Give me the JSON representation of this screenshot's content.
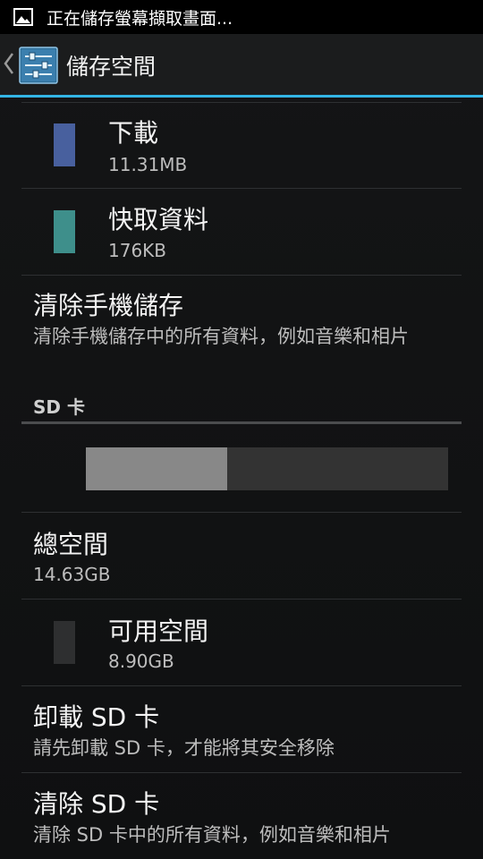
{
  "status_bar": {
    "notification_icon": "picture-icon",
    "text": "正在儲存螢幕擷取畫面..."
  },
  "action_bar": {
    "back_icon": "back-caret-icon",
    "app_icon": "settings-icon",
    "title": "儲存空間"
  },
  "internal_items": [
    {
      "label": "下載",
      "value": "11.31MB",
      "color": "#48609e"
    },
    {
      "label": "快取資料",
      "value": "176KB",
      "color": "#3e8f8b"
    }
  ],
  "erase_internal": {
    "title": "清除手機儲存",
    "summary": "清除手機儲存中的所有資料，例如音樂和相片"
  },
  "sd_section": {
    "header": "SD 卡",
    "usage_fraction": 0.39,
    "used_color": "#888888",
    "free_color": "#333333",
    "total": {
      "label": "總空間",
      "value": "14.63GB"
    },
    "available": {
      "label": "可用空間",
      "value": "8.90GB",
      "color": "#2e2f30"
    },
    "unmount": {
      "title": "卸載 SD 卡",
      "summary": "請先卸載 SD 卡，才能將其安全移除"
    },
    "erase": {
      "title": "清除 SD 卡",
      "summary": "清除 SD 卡中的所有資料，例如音樂和相片"
    }
  },
  "colors": {
    "accent": "#33b5e5"
  }
}
